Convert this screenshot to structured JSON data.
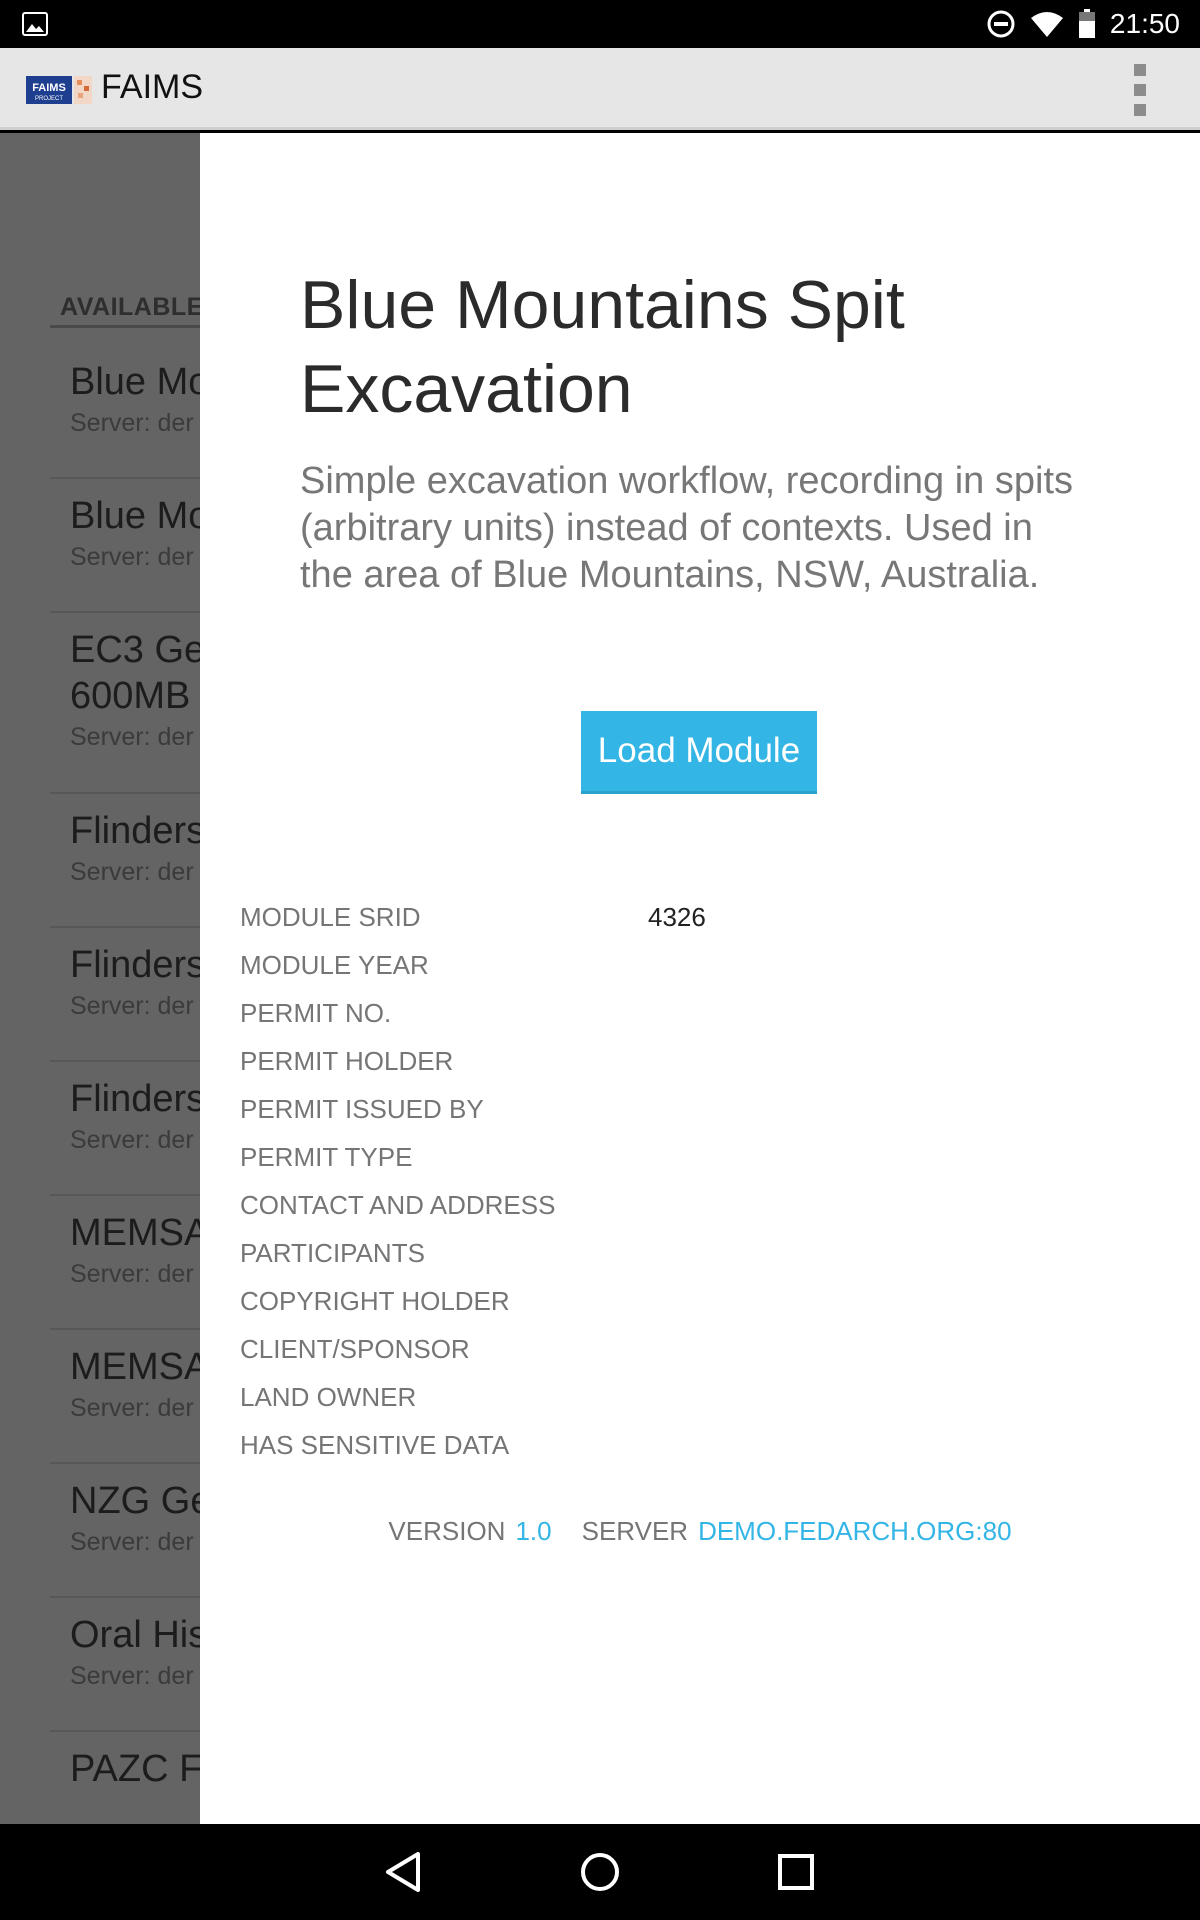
{
  "status_bar": {
    "time": "21:50",
    "icons": [
      "image-icon",
      "do-not-disturb-icon",
      "wifi-icon",
      "battery-icon"
    ]
  },
  "action_bar": {
    "app_title": "FAIMS",
    "logo_text": "FAIMS",
    "logo_subtext": "PROJECT",
    "overflow_icon": "overflow-menu-icon"
  },
  "background_list": {
    "section_header": "AVAILABLE",
    "items": [
      {
        "title": "Blue Mo",
        "subtitle": "Server: der"
      },
      {
        "title": "Blue Mo",
        "subtitle": "Server: der"
      },
      {
        "title": "EC3 Ge",
        "title2": "600MB",
        "subtitle": "Server: der"
      },
      {
        "title": "Flinders",
        "subtitle": "Server: der"
      },
      {
        "title": "Flinders",
        "subtitle": "Server: der"
      },
      {
        "title": "Flinders",
        "subtitle": "Server: der"
      },
      {
        "title": "MEMSA",
        "subtitle": "Server: der"
      },
      {
        "title": "MEMSA",
        "subtitle": "Server: der"
      },
      {
        "title": "NZG Ge",
        "subtitle": "Server: der"
      },
      {
        "title": "Oral His",
        "subtitle": "Server: der"
      },
      {
        "title": "PAZC F",
        "subtitle": ""
      }
    ]
  },
  "dialog": {
    "heading": "Blue Mountains Spit Excavation",
    "description": "Simple excavation workflow, recording in spits (arbitrary units) instead of contexts. Used in the area of Blue Mountains, NSW, Australia.",
    "load_button": "Load Module",
    "metadata": [
      {
        "label": "MODULE SRID",
        "value": "4326"
      },
      {
        "label": "MODULE YEAR",
        "value": ""
      },
      {
        "label": "PERMIT NO.",
        "value": ""
      },
      {
        "label": "PERMIT HOLDER",
        "value": ""
      },
      {
        "label": "PERMIT ISSUED BY",
        "value": ""
      },
      {
        "label": "PERMIT TYPE",
        "value": ""
      },
      {
        "label": "CONTACT AND ADDRESS",
        "value": ""
      },
      {
        "label": "PARTICIPANTS",
        "value": ""
      },
      {
        "label": "COPYRIGHT HOLDER",
        "value": ""
      },
      {
        "label": "CLIENT/SPONSOR",
        "value": ""
      },
      {
        "label": "LAND OWNER",
        "value": ""
      },
      {
        "label": "HAS SENSITIVE DATA",
        "value": ""
      }
    ],
    "footer": {
      "version_label": "VERSION",
      "version_value": "1.0",
      "server_label": "SERVER",
      "server_value": "DEMO.FEDARCH.ORG:80"
    }
  },
  "nav_bar": {
    "icons": [
      "back-icon",
      "home-icon",
      "recents-icon"
    ]
  },
  "colors": {
    "accent": "#33b5e5",
    "action_bar_bg": "#e6e6e6",
    "scrim": "#646464"
  }
}
